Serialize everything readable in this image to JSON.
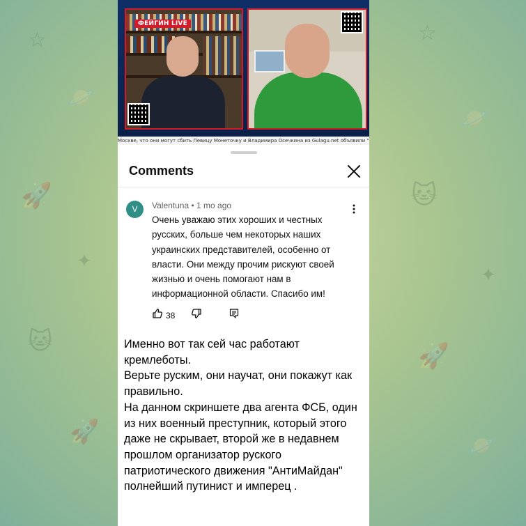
{
  "video": {
    "live_badge": "ФЕЙГИН LIVE",
    "ticker": "Москве, что они могут сбить   Певицу Монеточку и Владимира Осечкина из Gulagu.net объявили \"иноагентами\"   Р"
  },
  "comments_panel": {
    "title": "Comments",
    "comment": {
      "avatar_letter": "V",
      "author": "Valentuna",
      "separator": " • ",
      "time": "1 mo ago",
      "text": "Очень уважаю этих хороших и честных русских, больше чем некоторых наших украинских представителей, особенно от власти. Они между прочим рискуют своей жизнью и очень помогают нам в информационной области. Спасибо им!",
      "likes": "38"
    }
  },
  "post": {
    "lines": [
      "Именно вот так сей час работают кремлеботы.",
      "Верьте руским, они научат, они покажут как правильно.",
      "На данном скриншете два агента ФСБ, один из них военный преступник, который этого даже не скрывает, второй же в недавнем прошлом организатор руского патриотического движения \"АнтиМайдан\" полнейший путинист и имперец ."
    ]
  },
  "colors": {
    "accent_red": "#d21c2c",
    "avatar_teal": "#2f8f86",
    "background_green": "#a9c590"
  }
}
